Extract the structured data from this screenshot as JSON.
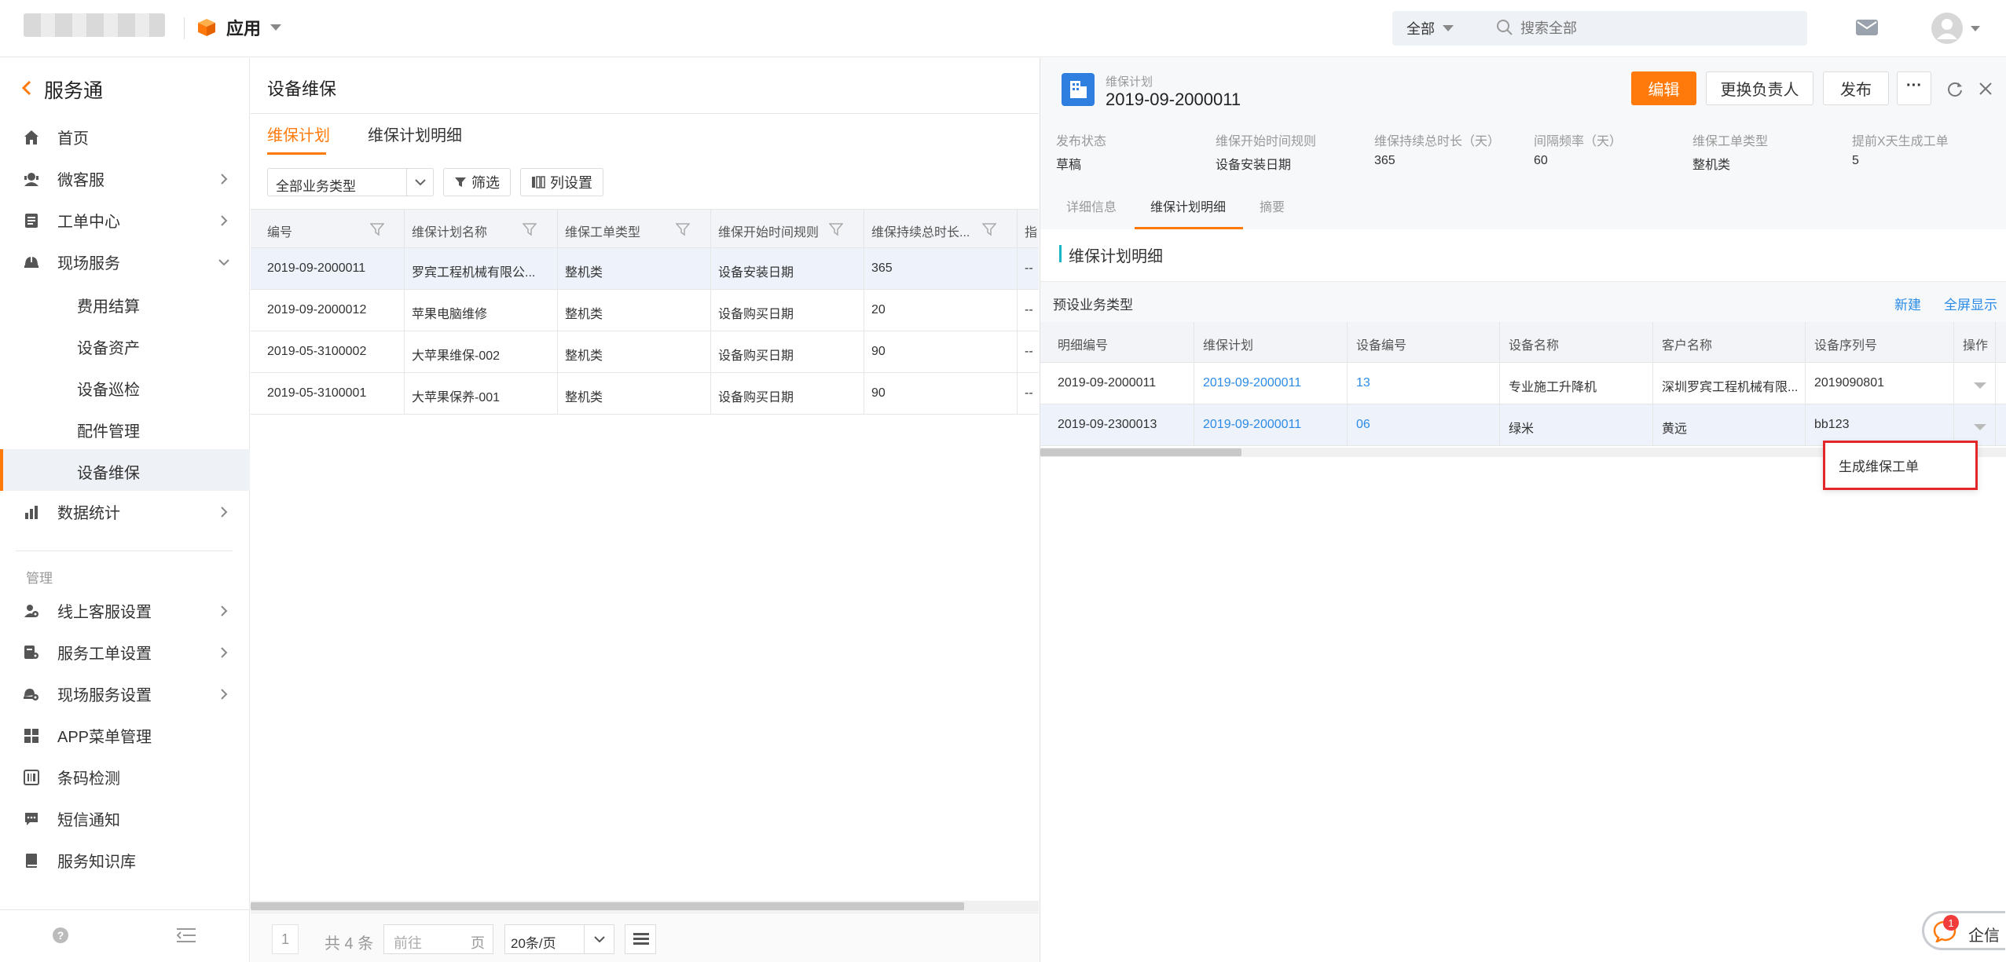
{
  "topbar": {
    "app_label": "应用",
    "scope_label": "全部",
    "search_placeholder": "搜索全部"
  },
  "sidebar": {
    "back_title": "服务通",
    "items": [
      {
        "label": "首页"
      },
      {
        "label": "微客服"
      },
      {
        "label": "工单中心"
      },
      {
        "label": "现场服务"
      }
    ],
    "sub_items": [
      {
        "label": "费用结算"
      },
      {
        "label": "设备资产"
      },
      {
        "label": "设备巡检"
      },
      {
        "label": "配件管理"
      },
      {
        "label": "设备维保"
      }
    ],
    "stats_label": "数据统计",
    "section_manage": "管理",
    "manage_items": [
      {
        "label": "线上客服设置"
      },
      {
        "label": "服务工单设置"
      },
      {
        "label": "现场服务设置"
      },
      {
        "label": "APP菜单管理"
      },
      {
        "label": "条码检测"
      },
      {
        "label": "短信通知"
      },
      {
        "label": "服务知识库"
      }
    ]
  },
  "main": {
    "title": "设备维保",
    "tabs": [
      {
        "label": "维保计划"
      },
      {
        "label": "维保计划明细"
      }
    ],
    "filter_select": "全部业务类型",
    "filter_button": "筛选",
    "columns_button": "列设置",
    "headers": [
      "编号",
      "维保计划名称",
      "维保工单类型",
      "维保开始时间规则",
      "维保持续总时长...",
      "指"
    ],
    "rows": [
      {
        "id": "2019-09-2000011",
        "name": "罗宾工程机械有限公...",
        "type": "整机类",
        "rule": "设备安装日期",
        "duration": "365",
        "extra": "--"
      },
      {
        "id": "2019-09-2000012",
        "name": "苹果电脑维修",
        "type": "整机类",
        "rule": "设备购买日期",
        "duration": "20",
        "extra": "--"
      },
      {
        "id": "2019-05-3100002",
        "name": "大苹果维保-002",
        "type": "整机类",
        "rule": "设备购买日期",
        "duration": "90",
        "extra": "--"
      },
      {
        "id": "2019-05-3100001",
        "name": "大苹果保养-001",
        "type": "整机类",
        "rule": "设备购买日期",
        "duration": "90",
        "extra": "--"
      }
    ],
    "pagination": {
      "page": "1",
      "total": "共 4 条",
      "goto_placeholder": "前往",
      "page_unit": "页",
      "page_size": "20条/页"
    }
  },
  "detail": {
    "type_label": "维保计划",
    "id": "2019-09-2000011",
    "buttons": {
      "edit": "编辑",
      "change_owner": "更换负责人",
      "publish": "发布",
      "more": "···"
    },
    "fields": [
      {
        "label": "发布状态",
        "value": "草稿"
      },
      {
        "label": "维保开始时间规则",
        "value": "设备安装日期"
      },
      {
        "label": "维保持续总时长（天）",
        "value": "365"
      },
      {
        "label": "间隔频率（天）",
        "value": "60"
      },
      {
        "label": "维保工单类型",
        "value": "整机类"
      },
      {
        "label": "提前X天生成工单",
        "value": "5"
      }
    ],
    "tabs": [
      {
        "label": "详细信息"
      },
      {
        "label": "维保计划明细"
      },
      {
        "label": "摘要"
      }
    ],
    "section_title": "维保计划明细",
    "subheader_label": "预设业务类型",
    "new_link": "新建",
    "fullscreen_link": "全屏显示",
    "headers": [
      "明细编号",
      "维保计划",
      "设备编号",
      "设备名称",
      "客户名称",
      "设备序列号",
      "操作"
    ],
    "rows": [
      {
        "detail_id": "2019-09-2000011",
        "plan": "2019-09-2000011",
        "device_no": "13",
        "device_name": "专业施工升降机",
        "customer": "深圳罗宾工程机械有限...",
        "serial": "2019090801"
      },
      {
        "detail_id": "2019-09-2300013",
        "plan": "2019-09-2000011",
        "device_no": "06",
        "device_name": "绿米",
        "customer": "黄远",
        "serial": "bb123"
      }
    ],
    "dropdown_item": "生成维保工单"
  },
  "chat": {
    "badge": "1",
    "label": "企信"
  },
  "colors": {
    "accent": "#ff7a0a",
    "link": "#2b8be6",
    "highlight_border": "#e3262a",
    "teal": "#1ab5c5"
  }
}
